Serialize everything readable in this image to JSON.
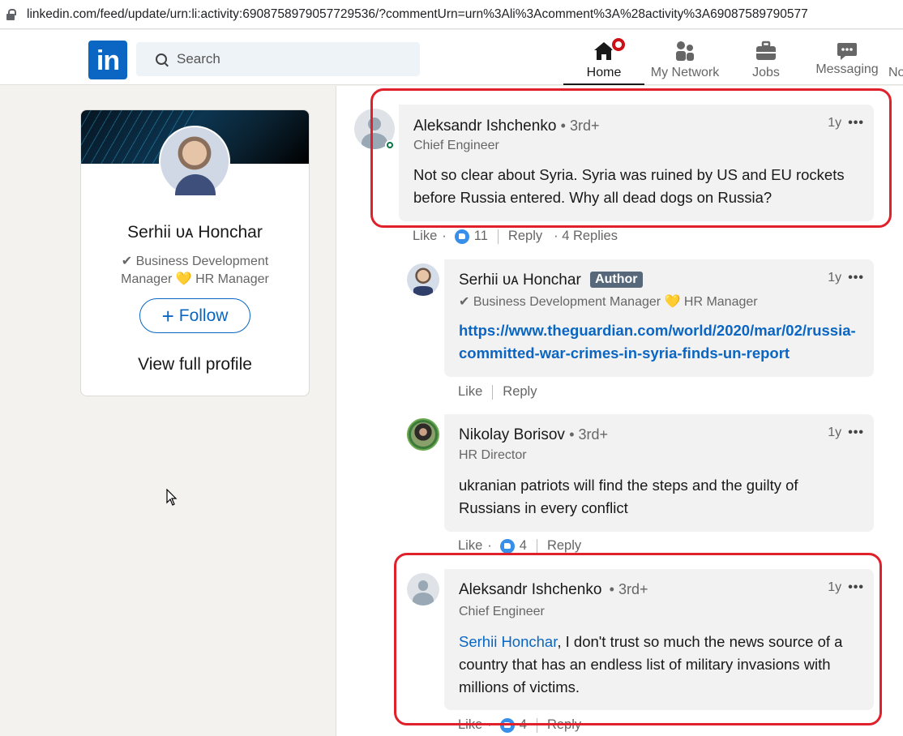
{
  "browser": {
    "url": "linkedin.com/feed/update/urn:li:activity:6908758979057729536/?commentUrn=urn%3Ali%3Acomment%3A%28activity%3A69087589790577"
  },
  "nav": {
    "logo": "in",
    "search_placeholder": "Search",
    "items": [
      {
        "label": "Home",
        "icon": "home-icon"
      },
      {
        "label": "My Network",
        "icon": "network-icon"
      },
      {
        "label": "Jobs",
        "icon": "briefcase-icon"
      },
      {
        "label": "Messaging",
        "icon": "messaging-icon"
      },
      {
        "label": "No"
      }
    ]
  },
  "profile_card": {
    "name": "Serhii ᴜᴀ Honchar",
    "headline": "✔ Business Development Manager 💛 HR Manager",
    "follow_label": "Follow",
    "view_profile_label": "View full profile"
  },
  "comments": [
    {
      "author": "Aleksandr Ishchenko",
      "degree": "• 3rd+",
      "headline": "Chief Engineer",
      "time": "1y",
      "text": "Not so clear about Syria. Syria was ruined by US and EU rockets before Russia entered. Why all dead dogs on Russia?",
      "like_label": "Like",
      "reaction_count": "11",
      "reply_label": "Reply",
      "replies_label": "· 4 Replies"
    },
    {
      "author": "Serhii ᴜᴀ Honchar",
      "author_badge": "Author",
      "headline": "✔ Business Development Manager 💛 HR Manager",
      "time": "1y",
      "link": "https://www.theguardian.com/world/2020/mar/02/russia-committed-war-crimes-in-syria-finds-un-report",
      "like_label": "Like",
      "reply_label": "Reply"
    },
    {
      "author": "Nikolay Borisov",
      "degree": "• 3rd+",
      "headline": "HR Director",
      "time": "1y",
      "text": "ukranian patriots will find the steps and the guilty of Russians in every conflict",
      "like_label": "Like",
      "reaction_count": "4",
      "reply_label": "Reply"
    },
    {
      "author": "Aleksandr Ishchenko",
      "degree": "• 3rd+",
      "headline": "Chief Engineer",
      "time": "1y",
      "mention": "Serhii Honchar",
      "text": ", I don't trust so much the news source of a country that has an endless list of military invasions with millions of victims.",
      "like_label": "Like",
      "reaction_count": "4",
      "reply_label": "Reply"
    }
  ],
  "colors": {
    "brand": "#0a66c2",
    "highlight": "#e0202a",
    "notification": "#cc1016"
  }
}
